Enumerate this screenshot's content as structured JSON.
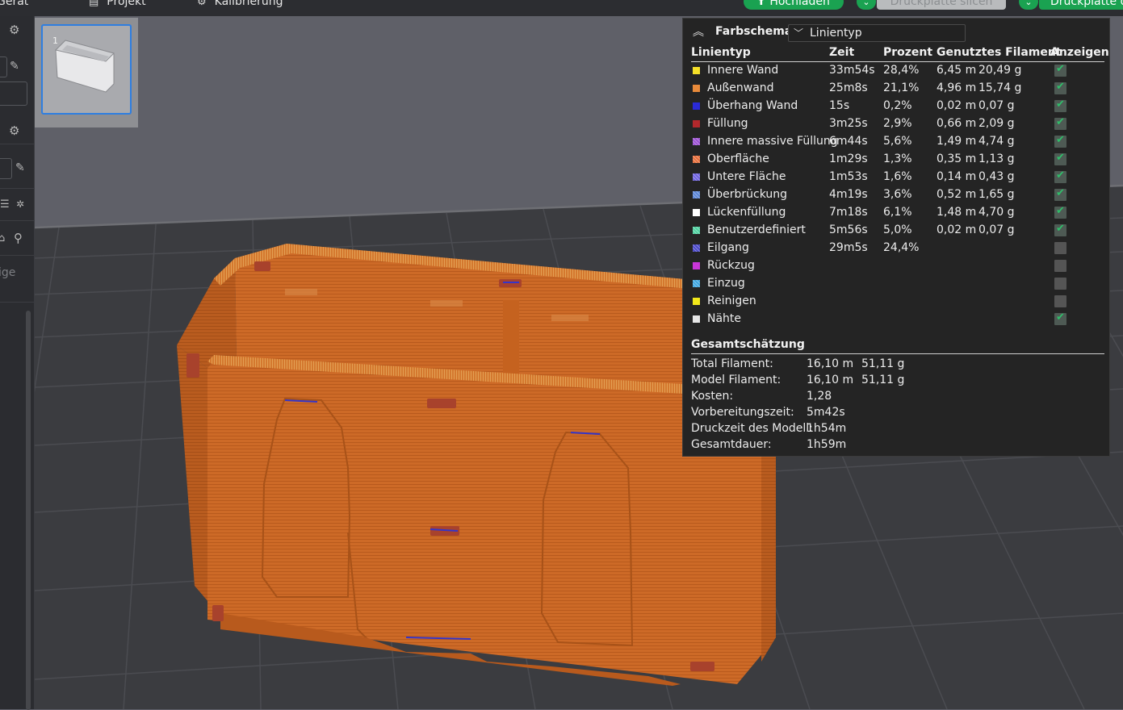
{
  "topbar": {
    "menu": [
      {
        "icon": "device-icon",
        "label": "Gerät"
      },
      {
        "icon": "project-icon",
        "label": "Projekt"
      },
      {
        "icon": "calibration-icon",
        "label": "Kalibrierung"
      }
    ],
    "upload_label": "Hochladen",
    "slice_plate_label": "Druckplatte slicen",
    "print_plate_label": "Druckplatte d"
  },
  "sidebar": {
    "partial_text": "ige"
  },
  "plate": {
    "thumbnail_number": "1"
  },
  "legend": {
    "title": "Farbschema",
    "selector_value": "Linientyp",
    "columns": {
      "type": "Linientyp",
      "time": "Zeit",
      "percent": "Prozent",
      "filament": "Genutztes Filament",
      "show": "Anzeigen"
    },
    "rows": [
      {
        "label": "Innere Wand",
        "color": "#f5e028",
        "time": "33m54s",
        "percent": "28,4%",
        "length": "6,45 m",
        "weight": "20,49 g",
        "shown": true
      },
      {
        "label": "Außenwand",
        "color": "#e88a3a",
        "time": "25m8s",
        "percent": "21,1%",
        "length": "4,96 m",
        "weight": "15,74 g",
        "shown": true
      },
      {
        "label": "Überhang Wand",
        "color": "#2a2ad6",
        "time": "15s",
        "percent": "0,2%",
        "length": "0,02 m",
        "weight": "0,07 g",
        "shown": true
      },
      {
        "label": "Füllung",
        "color": "#b2282c",
        "time": "3m25s",
        "percent": "2,9%",
        "length": "0,66 m",
        "weight": "2,09 g",
        "shown": true
      },
      {
        "label": "Innere massive Füllung",
        "color": "#9a4fd2",
        "time": "6m44s",
        "percent": "5,6%",
        "length": "1,49 m",
        "weight": "4,74 g",
        "shown": true
      },
      {
        "label": "Oberfläche",
        "color": "#e86e3a",
        "time": "1m29s",
        "percent": "1,3%",
        "length": "0,35 m",
        "weight": "1,13 g",
        "shown": true
      },
      {
        "label": "Untere Fläche",
        "color": "#6e62e0",
        "time": "1m53s",
        "percent": "1,6%",
        "length": "0,14 m",
        "weight": "0,43 g",
        "shown": true
      },
      {
        "label": "Überbrückung",
        "color": "#5b86d6",
        "time": "4m19s",
        "percent": "3,6%",
        "length": "0,52 m",
        "weight": "1,65 g",
        "shown": true
      },
      {
        "label": "Lückenfüllung",
        "color": "#ffffff",
        "time": "7m18s",
        "percent": "6,1%",
        "length": "1,48 m",
        "weight": "4,70 g",
        "shown": true
      },
      {
        "label": "Benutzerdefiniert",
        "color": "#4fd1a0",
        "time": "5m56s",
        "percent": "5,0%",
        "length": "0,02 m",
        "weight": "0,07 g",
        "shown": true
      },
      {
        "label": "Eilgang",
        "color": "#4a48c8",
        "time": "29m5s",
        "percent": "24,4%",
        "length": "",
        "weight": "",
        "shown": false
      },
      {
        "label": "Rückzug",
        "color": "#c936d8",
        "time": "",
        "percent": "",
        "length": "",
        "weight": "",
        "shown": false
      },
      {
        "label": "Einzug",
        "color": "#3fa6e0",
        "time": "",
        "percent": "",
        "length": "",
        "weight": "",
        "shown": false
      },
      {
        "label": "Reinigen",
        "color": "#f2e81a",
        "time": "",
        "percent": "",
        "length": "",
        "weight": "",
        "shown": false
      },
      {
        "label": "Nähte",
        "color": "#e6e6e6",
        "time": "",
        "percent": "",
        "length": "",
        "weight": "",
        "shown": true
      }
    ],
    "summary_title": "Gesamtschätzung",
    "summary": [
      {
        "key": "Total Filament:",
        "v1": "16,10 m",
        "v2": "51,11 g"
      },
      {
        "key": "Model Filament:",
        "v1": "16,10 m",
        "v2": "51,11 g"
      },
      {
        "key": "Kosten:",
        "v1": "1,28",
        "v2": ""
      },
      {
        "key": "Vorbereitungszeit:",
        "v1": "5m42s",
        "v2": ""
      },
      {
        "key": "Druckzeit des Modell:",
        "v1": "1h54m",
        "v2": ""
      },
      {
        "key": "Gesamtdauer:",
        "v1": "1h59m",
        "v2": ""
      }
    ]
  }
}
